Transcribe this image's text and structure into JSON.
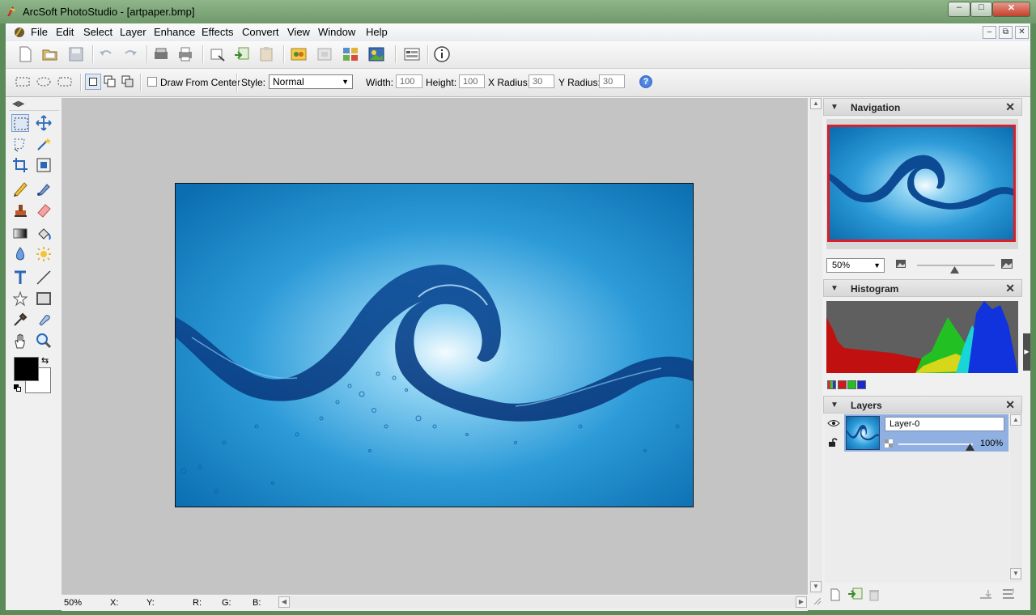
{
  "window": {
    "title": "ArcSoft PhotoStudio - [artpaper.bmp]",
    "controls": {
      "minimize": "–",
      "maximize": "□",
      "close": "✕"
    }
  },
  "menu": [
    "File",
    "Edit",
    "Select",
    "Layer",
    "Enhance",
    "Effects",
    "Convert",
    "View",
    "Window",
    "Help"
  ],
  "mdi_controls": {
    "minimize": "–",
    "restore": "⧉",
    "close": "✕"
  },
  "toolbar1": {
    "icons": [
      "new-icon",
      "open-icon",
      "save-icon",
      "undo-icon",
      "redo-icon",
      "scan-icon",
      "print-icon",
      "import-icon",
      "acquire-icon",
      "paste-icon",
      "photo-icon",
      "frame-icon",
      "slideshow-icon",
      "gallery-icon",
      "browser-icon",
      "info-icon"
    ]
  },
  "toolbar2": {
    "draw_from_center_label": "Draw From Center",
    "draw_from_center_checked": false,
    "style_label": "Style:",
    "style_value": "Normal",
    "width_label": "Width:",
    "width_value": "100",
    "height_label": "Height:",
    "height_value": "100",
    "xradius_label": "X Radius:",
    "xradius_value": "30",
    "yradius_label": "Y Radius:",
    "yradius_value": "30",
    "help_icon": "?"
  },
  "tools": [
    "marquee-tool",
    "move-tool",
    "lasso-tool",
    "magic-wand-tool",
    "crop-tool",
    "transform-tool",
    "pencil-tool",
    "brush-tool",
    "clone-tool",
    "eraser-tool",
    "gradient-tool",
    "fill-tool",
    "blur-tool",
    "brightness-tool",
    "text-tool",
    "line-tool",
    "shape-tool",
    "rectangle-tool",
    "eyedropper-tool",
    "smudge-tool",
    "hand-tool",
    "zoom-tool"
  ],
  "colors": {
    "foreground": "#000000",
    "background": "#ffffff",
    "accent": "#3a6ea5",
    "nav_border": "#d8202a"
  },
  "status": {
    "zoom": "50%",
    "x": "X:",
    "y": "Y:",
    "r": "R:",
    "g": "G:",
    "b": "B:"
  },
  "navigation": {
    "title": "Navigation",
    "zoom": "50%",
    "zoom_level": 0.48
  },
  "histogram": {
    "title": "Histogram"
  },
  "layers": {
    "title": "Layers",
    "layer_name": "Layer-0",
    "opacity": "100%"
  }
}
